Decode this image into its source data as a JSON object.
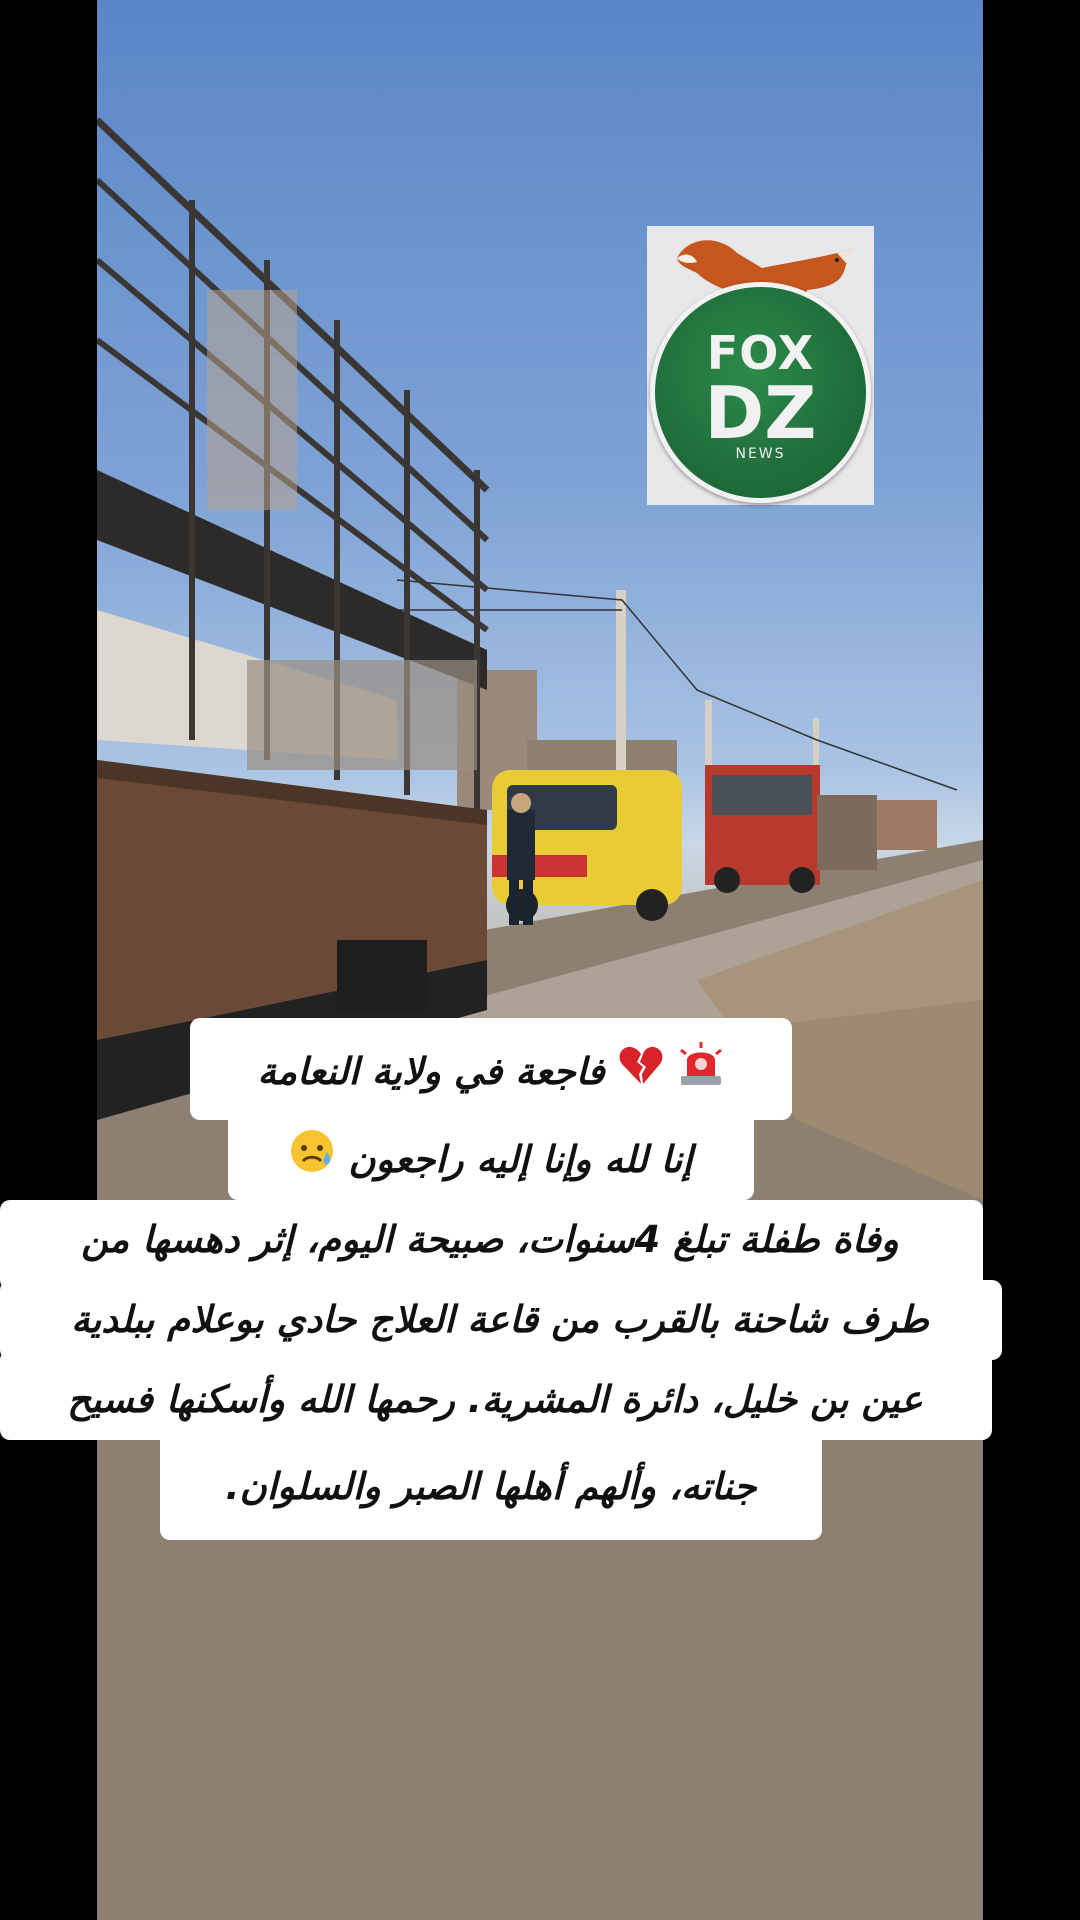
{
  "logo": {
    "line1": "FOX",
    "line2": "DZ",
    "line3": "NEWS"
  },
  "caption": {
    "headline": "فاجعة في ولاية النعامة",
    "headline_icons": [
      "siren-emoji",
      "broken-heart-emoji"
    ],
    "condolence": "إنا لله وإنا إليه راجعون",
    "condolence_icon": "sad-relieved-face-emoji",
    "body_lines": [
      "وفاة طفلة تبلغ 4سنوات، صبيحة اليوم، إثر دهسها من",
      "طرف شاحنة بالقرب من قاعة العلاج حادي بوعلام ببلدية",
      "عين بن خليل، دائرة المشرية. رحمها الله وأسكنها فسيح",
      "جناته، وألهم أهلها الصبر والسلوان."
    ]
  },
  "colors": {
    "logo_green": "#1f6e3a",
    "caption_bg": "#ffffff",
    "ambulance_yellow": "#e8c832"
  }
}
